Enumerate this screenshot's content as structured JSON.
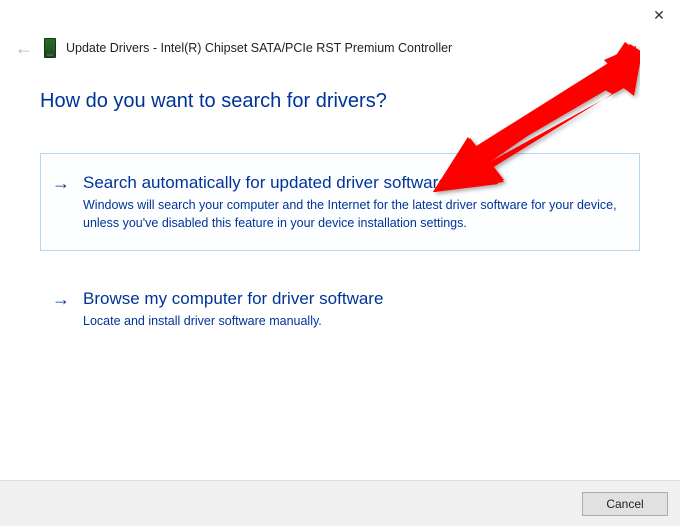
{
  "titlebar": {
    "close_icon": "✕"
  },
  "header": {
    "back_icon": "←",
    "title": "Update Drivers - Intel(R) Chipset SATA/PCIe RST Premium Controller"
  },
  "main": {
    "heading": "How do you want to search for drivers?",
    "options": [
      {
        "arrow": "→",
        "title": "Search automatically for updated driver software",
        "description": "Windows will search your computer and the Internet for the latest driver software for your device, unless you've disabled this feature in your device installation settings."
      },
      {
        "arrow": "→",
        "title": "Browse my computer for driver software",
        "description": "Locate and install driver software manually."
      }
    ]
  },
  "footer": {
    "cancel_label": "Cancel"
  },
  "annotation": {
    "arrow_color": "#ff0000"
  }
}
